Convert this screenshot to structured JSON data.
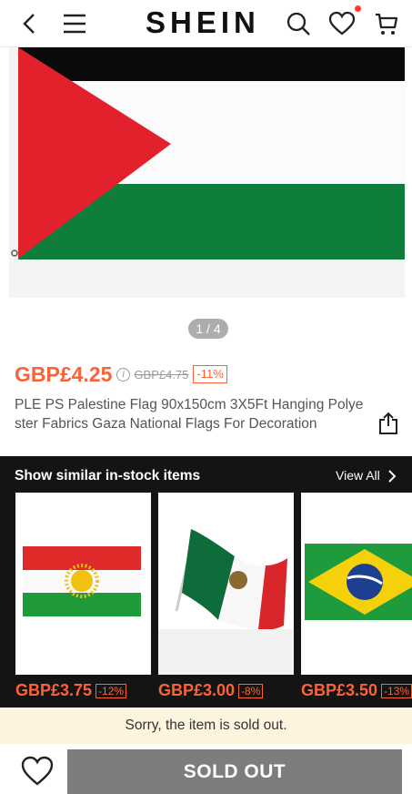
{
  "header": {
    "logo": "SHEIN",
    "icons": [
      "back-icon",
      "menu-icon",
      "search-icon",
      "wishlist-icon",
      "cart-icon"
    ]
  },
  "gallery": {
    "pager": "1 / 4"
  },
  "product": {
    "price": "GBP£4.25",
    "original_price": "GBP£4.75",
    "discount": "-11%",
    "title": "PLE PS Palestine Flag 90x150cm 3X5Ft Hanging Polyester Fabrics Gaza National Flags For Decoration"
  },
  "similar": {
    "title": "Show similar in-stock items",
    "view_all": "View All",
    "items": [
      {
        "price": "GBP£3.75",
        "discount": "-12%"
      },
      {
        "price": "GBP£3.00",
        "discount": "-8%"
      },
      {
        "price": "GBP£3.50",
        "discount": "-13%"
      }
    ]
  },
  "notice": "Sorry, the item is sold out.",
  "bottom": {
    "sold_out_label": "SOLD OUT"
  },
  "colors": {
    "accent": "#fa6338",
    "notice_bg": "#fdf4de",
    "sold_out_bg": "#7d7d7d"
  }
}
